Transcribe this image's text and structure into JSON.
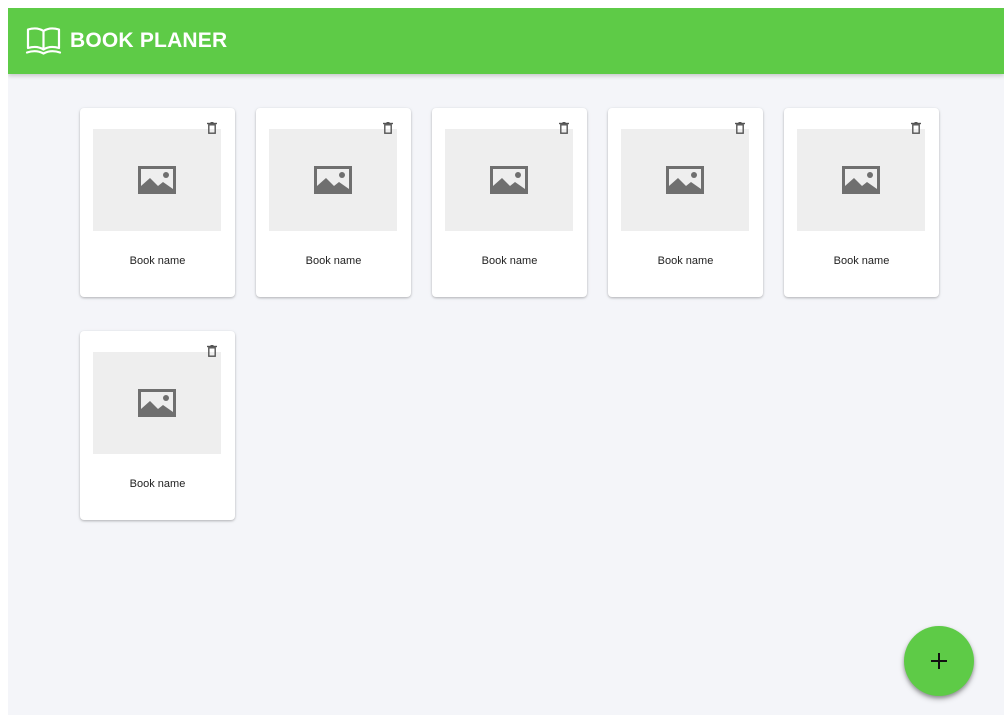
{
  "app": {
    "title": "BOOK PLANER",
    "logo_icon": "open-book-icon",
    "brand_color": "#5ecb47",
    "background_color": "#f4f5f9"
  },
  "books": [
    {
      "name": "Book name",
      "image_icon": "image-placeholder-icon",
      "delete_icon": "trash-icon"
    },
    {
      "name": "Book name",
      "image_icon": "image-placeholder-icon",
      "delete_icon": "trash-icon"
    },
    {
      "name": "Book name",
      "image_icon": "image-placeholder-icon",
      "delete_icon": "trash-icon"
    },
    {
      "name": "Book name",
      "image_icon": "image-placeholder-icon",
      "delete_icon": "trash-icon"
    },
    {
      "name": "Book name",
      "image_icon": "image-placeholder-icon",
      "delete_icon": "trash-icon"
    },
    {
      "name": "Book name",
      "image_icon": "image-placeholder-icon",
      "delete_icon": "trash-icon"
    }
  ],
  "fab": {
    "icon": "plus-icon"
  }
}
